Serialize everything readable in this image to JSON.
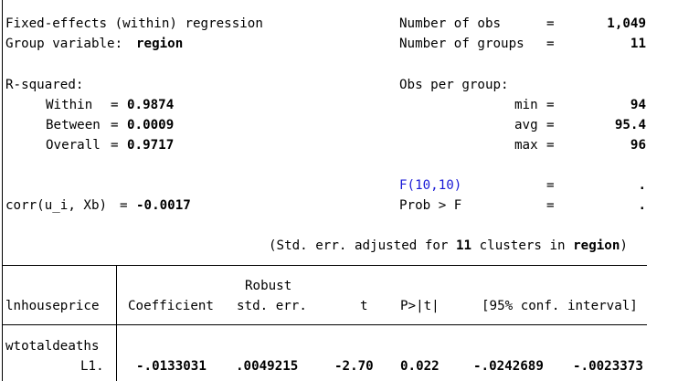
{
  "header": {
    "title": "Fixed-effects (within) regression",
    "group_var_label": "Group variable:",
    "group_var_value": "region",
    "nobs_label": "Number of obs",
    "nobs_value": "1,049",
    "ngroups_label": "Number of groups",
    "ngroups_value": "11",
    "eq": "="
  },
  "rsq": {
    "label": "R-squared:",
    "within_label": "Within",
    "within_value": "0.9874",
    "between_label": "Between",
    "between_value": "0.0009",
    "overall_label": "Overall",
    "overall_value": "0.9717"
  },
  "obs_per_group": {
    "label": "Obs per group:",
    "min_label": "min",
    "min_value": "94",
    "avg_label": "avg",
    "avg_value": "95.4",
    "max_label": "max",
    "max_value": "96"
  },
  "ftest": {
    "f_label": "F(10,10)",
    "f_value": ".",
    "prob_label": "Prob > F",
    "prob_value": "."
  },
  "corr": {
    "label": "corr(u_i, Xb)",
    "value": "-0.0017"
  },
  "note": {
    "prefix": "(Std. err. adjusted for ",
    "clusters": "11",
    "middle": " clusters in ",
    "var": "region",
    "suffix": ")"
  },
  "table": {
    "depvar": "lnhouseprice",
    "robust_label": "Robust",
    "col_coef": "Coefficient",
    "col_se": "std. err.",
    "col_t": "t",
    "col_p": "P>|t|",
    "col_ci": "[95% conf. interval]",
    "var_name": "wtotaldeaths",
    "row_label": "L1.",
    "coef": "-.0133031",
    "se": ".0049215",
    "t": "-2.70",
    "p": "0.022",
    "ci_low": "-.0242689",
    "ci_high": "-.0023373"
  }
}
